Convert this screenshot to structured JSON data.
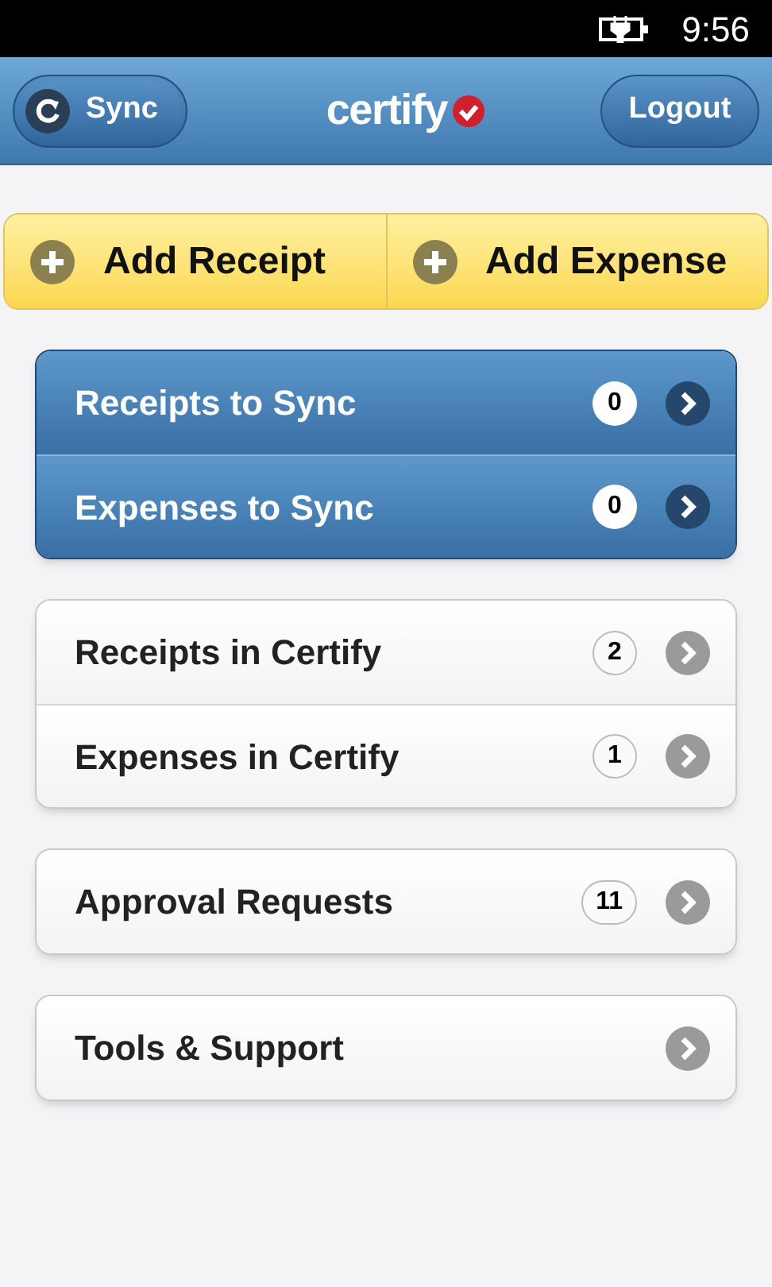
{
  "status_bar": {
    "time": "9:56"
  },
  "header": {
    "sync_button": "Sync",
    "logo": "certify",
    "logout_button": "Logout"
  },
  "add_buttons": [
    "Add Receipt",
    "Add Expense"
  ],
  "groups": [
    {
      "kind": "dark",
      "items": [
        {
          "label": "Receipts to Sync",
          "count": "0"
        },
        {
          "label": "Expenses to Sync",
          "count": "0"
        }
      ]
    },
    {
      "kind": "light",
      "items": [
        {
          "label": "Receipts in Certify",
          "count": "2"
        },
        {
          "label": "Expenses in Certify",
          "count": "1"
        }
      ]
    },
    {
      "kind": "light",
      "items": [
        {
          "label": "Approval Requests",
          "count": "11"
        }
      ]
    },
    {
      "kind": "light",
      "items": [
        {
          "label": "Tools & Support"
        }
      ]
    }
  ]
}
